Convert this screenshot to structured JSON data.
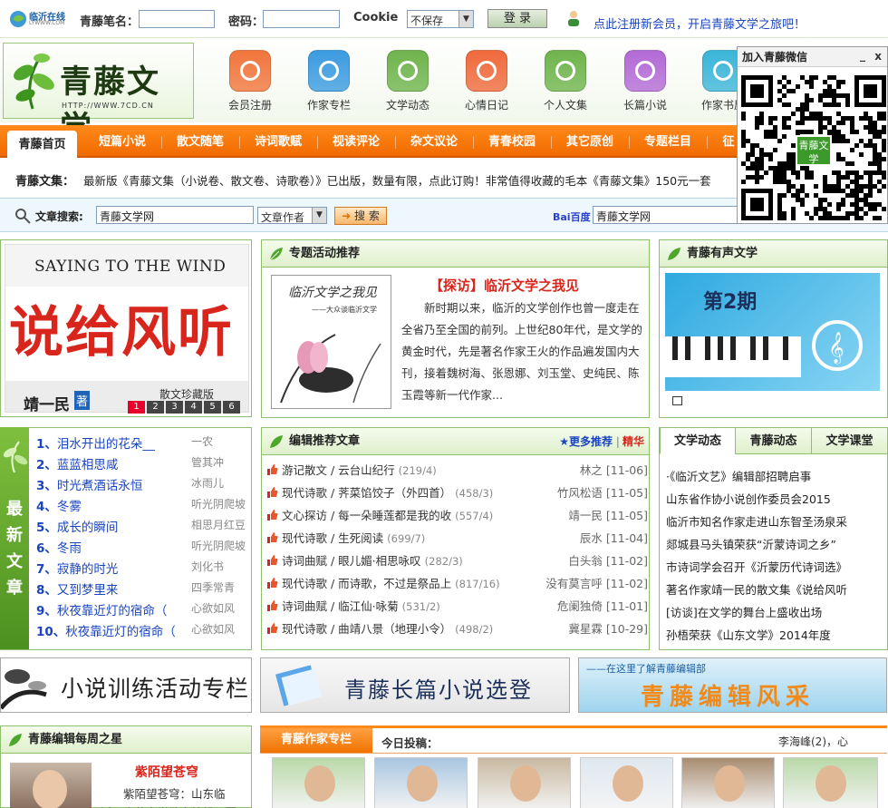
{
  "topbar": {
    "site_mini_logo": "临沂在线",
    "site_mini_logo_sub": "LYWWW.COM",
    "username_label": "青藤笔名：",
    "password_label": "密码：",
    "cookie_label": "Cookie",
    "cookie_option": "不保存",
    "login_button": "登 录",
    "register_link": "点此注册新会员，开启青藤文学之旅吧！"
  },
  "logo": {
    "title": "青藤文学",
    "url": "HTTP://WWW.7CD.CN"
  },
  "nav_icons": [
    {
      "label": "会员注册",
      "icon": "compass-icon",
      "color": "#f0763c"
    },
    {
      "label": "作家专栏",
      "icon": "people-icon",
      "color": "#3b9be0"
    },
    {
      "label": "文学动态",
      "icon": "search-icon",
      "color": "#6fb44c"
    },
    {
      "label": "心情日记",
      "icon": "chat-icon",
      "color": "#f06a3c"
    },
    {
      "label": "个人文集",
      "icon": "ie-icon",
      "color": "#6fb44c"
    },
    {
      "label": "长篇小说",
      "icon": "download-icon",
      "color": "#b36ad6"
    },
    {
      "label": "作家书屋",
      "icon": "book-icon",
      "color": "#3bb5d8"
    }
  ],
  "nav": {
    "home": "青藤首页",
    "items": [
      "短篇小说",
      "散文随笔",
      "诗词歌赋",
      "视读评论",
      "杂文议论",
      "青春校园",
      "其它原创",
      "专题栏目",
      "征文"
    ]
  },
  "notice": {
    "label": "青藤文集：",
    "text": "最新版《青藤文集（小说卷、散文卷、诗歌卷）》已出版，数量有限，点此订购！非常值得收藏的毛本《青藤文集》150元一套"
  },
  "search": {
    "label": "文章搜索:",
    "input_value": "青藤文学网",
    "type_option": "文章作者",
    "button": "搜 索",
    "baidu_logo": "Bai百度",
    "baidu_value": "青藤文学网"
  },
  "wechat": {
    "title": "加入青藤微信",
    "minimize": "_",
    "close": "x",
    "qr_center": "青藤文学"
  },
  "slider": {
    "top_text": "SAYING TO THE WIND",
    "big_text": "说给风听",
    "author": "靖一民",
    "badge": "著",
    "edition": "散文珍藏版",
    "pages": [
      "1",
      "2",
      "3",
      "4",
      "5",
      "6"
    ],
    "active_page": "1"
  },
  "special": {
    "title": "专题活动推荐",
    "book_cover_title": "临沂文学之我见",
    "book_cover_sub": "——大众谈临沂文学",
    "headline": "【探访】临沂文学之我见",
    "body": "新时期以来，临沂的文学创作也曾一度走在全省乃至全国的前列。上世纪80年代，是文学的黄金时代，先是著名作家王火的作品遍发国内大刊，接着魏树海、张恩娜、刘玉堂、史纯民、陈玉霞等新一代作家..."
  },
  "audio": {
    "title": "青藤有声文学",
    "issue": "第2期"
  },
  "latest": {
    "side_label": "最新文章",
    "items": [
      {
        "n": "1、",
        "title": "泪水开出的花朵__",
        "author": "一农"
      },
      {
        "n": "2、",
        "title": "蓝蓝相思咸",
        "author": "管其冲"
      },
      {
        "n": "3、",
        "title": "时光煮酒话永恒",
        "author": "冰雨儿"
      },
      {
        "n": "4、",
        "title": "冬雾",
        "author": "听光阴爬坡"
      },
      {
        "n": "5、",
        "title": "成长的瞬间",
        "author": "相思月红豆"
      },
      {
        "n": "6、",
        "title": "冬雨",
        "author": "听光阴爬坡"
      },
      {
        "n": "7、",
        "title": "寂静的时光",
        "author": "刘化书"
      },
      {
        "n": "8、",
        "title": "又到梦里来",
        "author": "四季常青"
      },
      {
        "n": "9、",
        "title": "秋夜靠近灯的宿命（",
        "author": "心欲如风"
      },
      {
        "n": "10、",
        "title": "秋夜靠近灯的宿命（",
        "author": "心欲如风"
      }
    ]
  },
  "editor": {
    "title": "编辑推荐文章",
    "more": "★更多推荐",
    "elite": "精华",
    "rows": [
      {
        "cat": "游记散文 /",
        "title": "云台山纪行",
        "count": "(219/4)",
        "author": "林之",
        "date": "[11-06]"
      },
      {
        "cat": "现代诗歌 /",
        "title": "荠菜馅饺子（外四首）",
        "count": "(458/3)",
        "author": "竹风松语",
        "date": "[11-05]"
      },
      {
        "cat": "文心探访 /",
        "title": "每一朵睡莲都是我的收",
        "count": "(557/4)",
        "author": "靖一民",
        "date": "[11-05]"
      },
      {
        "cat": "现代诗歌 /",
        "title": "生死阅读",
        "count": "(699/7)",
        "author": "辰水",
        "date": "[11-04]"
      },
      {
        "cat": "诗词曲赋 /",
        "title": "眼儿媚·相思咏叹",
        "count": "(282/3)",
        "author": "白头翁",
        "date": "[11-02]"
      },
      {
        "cat": "现代诗歌 /",
        "title": "而诗歌，不过是祭品上",
        "count": "(817/16)",
        "author": "没有莫言呼",
        "date": "[11-02]"
      },
      {
        "cat": "诗词曲赋 /",
        "title": "临江仙·咏菊",
        "count": "(531/2)",
        "author": "危阑独倚",
        "date": "[11-01]"
      },
      {
        "cat": "现代诗歌 /",
        "title": "曲靖八景（地理小令）",
        "count": "(498/2)",
        "author": "冀星霖",
        "date": "[10-29]"
      }
    ]
  },
  "news": {
    "tabs": [
      "文学动态",
      "青藤动态",
      "文学课堂"
    ],
    "items": [
      "·《临沂文艺》编辑部招聘启事",
      "山东省作协小说创作委员会2015",
      "临沂市知名作家走进山东智圣汤泉采",
      "郯城县马头镇荣获“沂蒙诗词之乡”",
      "市诗词学会召开《沂蒙历代诗词选》",
      "著名作家靖一民的散文集《说给风听",
      "[访谈]在文学的舞台上盛收出场",
      "孙梧荣获《山东文学》2014年度"
    ]
  },
  "banners": {
    "novel": "小说训练活动专栏",
    "long": "青藤长篇小说选登",
    "editor_sub": "——在这里了解青藤编辑部",
    "editor": "青藤编辑风采"
  },
  "weekly": {
    "title": "青藤编辑每周之星",
    "name": "紫陌望苍穹",
    "desc": "紫陌望苍穹：山东临沂，青藤文学散文编辑，因"
  },
  "writers": {
    "tab": "青藤作家专栏",
    "today_label": "今日投稿：",
    "today_value": "李海峰(2)，心"
  }
}
